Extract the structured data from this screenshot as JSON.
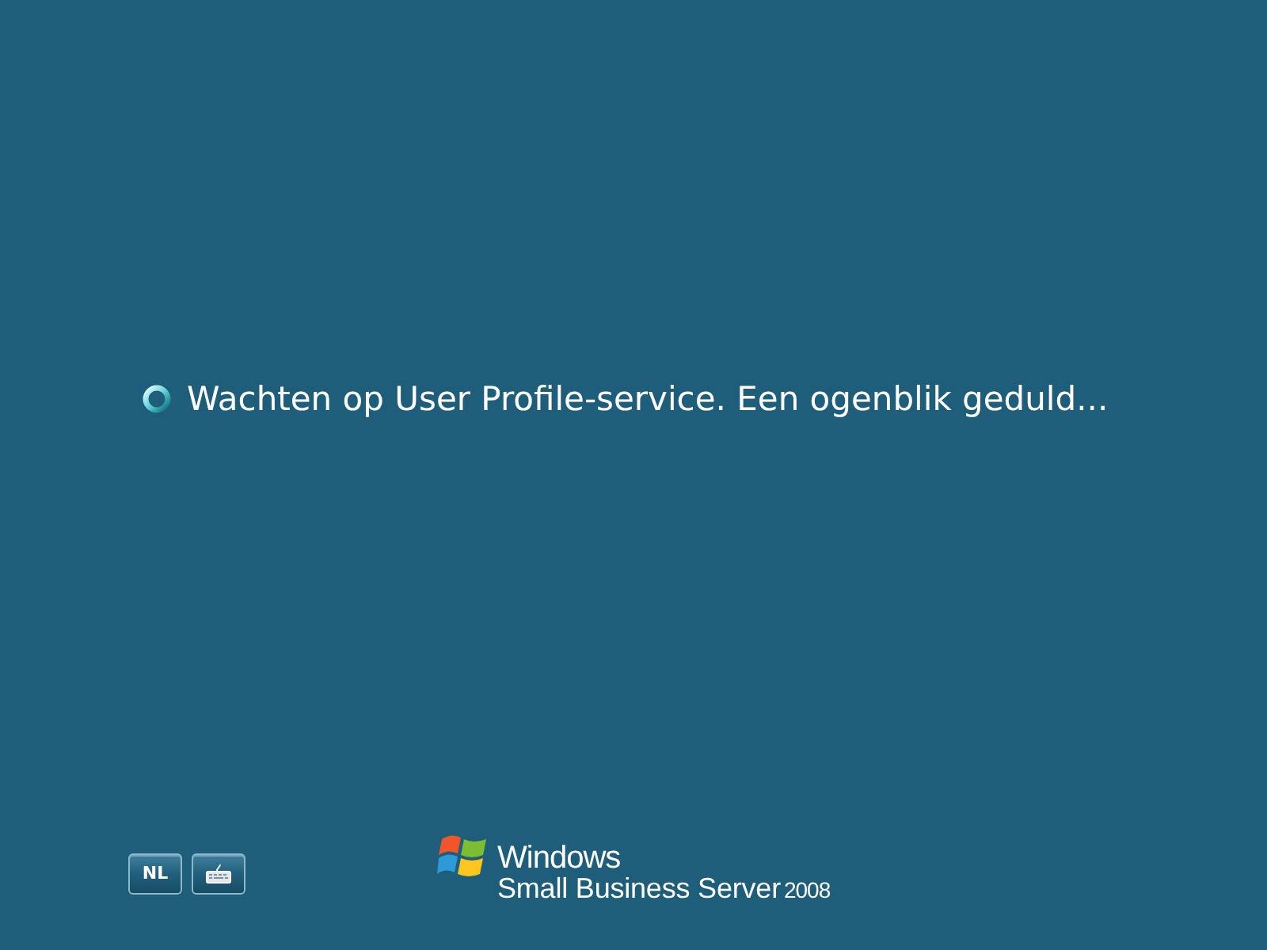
{
  "status": {
    "message": "Wachten op User Profile-service. Een ogenblik geduld..."
  },
  "bottom_buttons": [
    {
      "kind": "text",
      "label": "NL"
    },
    {
      "kind": "keyboard"
    }
  ],
  "logo": {
    "line_1": "Windows",
    "line_2": "Small Business Server",
    "year": "2008"
  }
}
